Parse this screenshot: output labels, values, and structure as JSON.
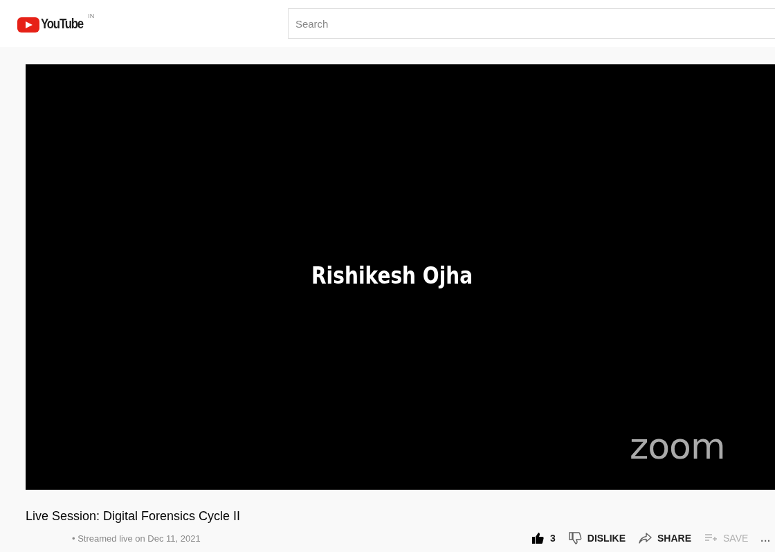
{
  "header": {
    "logo_text": "YouTube",
    "region": "IN",
    "search": {
      "placeholder": "Search"
    }
  },
  "video": {
    "participant_name": "Rishikesh Ojha",
    "watermark": "zoom"
  },
  "title": "Live Session: Digital Forensics Cycle II",
  "meta": "• Streamed live on Dec 11, 2021",
  "actions": [
    {
      "kind": "like",
      "label": "3",
      "selected": true,
      "disabled": false
    },
    {
      "kind": "dislike",
      "label": "DISLIKE",
      "selected": false,
      "disabled": false
    },
    {
      "kind": "share",
      "label": "SHARE",
      "disabled": false
    },
    {
      "kind": "save",
      "label": "SAVE",
      "disabled": true
    },
    {
      "kind": "more",
      "label": "...",
      "disabled": false
    }
  ]
}
